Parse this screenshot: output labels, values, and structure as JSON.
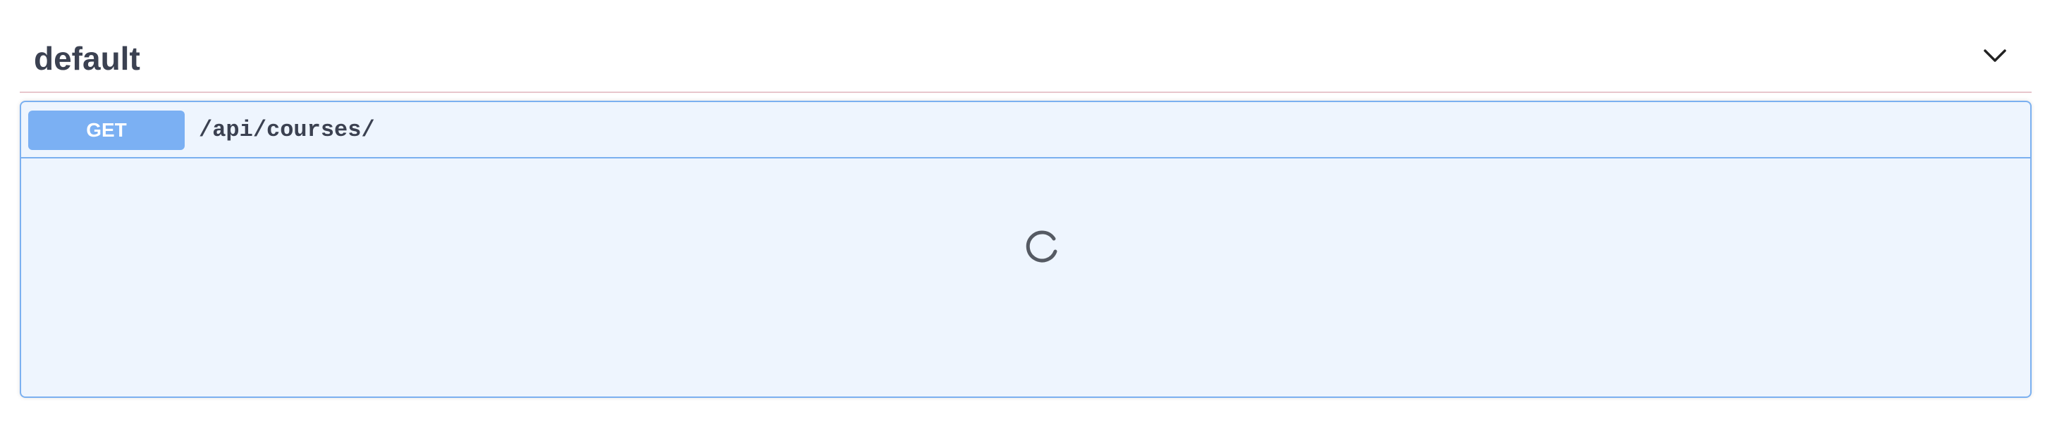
{
  "section": {
    "title": "default",
    "toggle_icon": "chevron-down-icon"
  },
  "operation": {
    "method": "GET",
    "path": "/api/courses/",
    "method_color": "#7bb0f3",
    "border_color": "#7bb0f0",
    "background_color": "#eef5fe"
  },
  "body": {
    "state": "loading",
    "spinner_icon": "loading-spinner-icon"
  }
}
